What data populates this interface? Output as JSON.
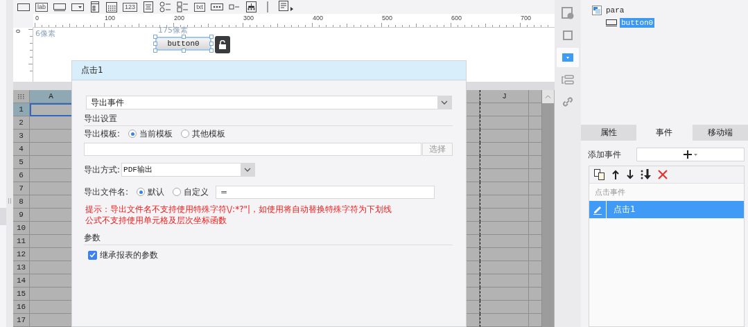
{
  "toolbar": [
    {
      "kind": "textbox"
    },
    {
      "kind": "label",
      "text": "lab"
    },
    {
      "kind": "button"
    },
    {
      "kind": "combo"
    },
    {
      "kind": "form"
    },
    {
      "kind": "calendar"
    },
    {
      "kind": "number",
      "text": "123"
    },
    {
      "kind": "textarea"
    },
    {
      "kind": "radio-group"
    },
    {
      "kind": "check-group"
    },
    {
      "kind": "text",
      "text": "txt"
    },
    {
      "kind": "password"
    },
    {
      "kind": "checkbox"
    },
    {
      "kind": "tree"
    },
    {
      "kind": "separator"
    },
    {
      "kind": "more"
    }
  ],
  "ruler": {
    "x_labels": [
      "0",
      "100",
      "200",
      "300",
      "400",
      "500",
      "600",
      "700"
    ],
    "y_label": "0"
  },
  "canvas": {
    "left_gap": "6像素",
    "top_gap": "175像素",
    "widget": {
      "text": "button0",
      "selected": true
    }
  },
  "dialog": {
    "title": "点击1",
    "event_type": "导出事件",
    "export_section": "导出设置",
    "template": {
      "label": "导出模板:",
      "options": [
        {
          "label": "当前模板",
          "selected": true
        },
        {
          "label": "其他模板",
          "selected": false
        }
      ],
      "browse_button": "选择"
    },
    "method": {
      "label": "导出方式:",
      "value": "PDF输出"
    },
    "filename": {
      "label": "导出文件名:",
      "options": [
        {
          "label": "默认",
          "selected": true
        },
        {
          "label": "自定义",
          "selected": false
        }
      ],
      "value": "="
    },
    "hint": [
      "提示：导出文件名不支持使用特殊字符\\/:*?\"|，如使用将自动替换特殊字符为下划线",
      "公式不支持使用单元格及层次坐标函数"
    ],
    "params_section": "参数",
    "inherit": {
      "label": "继承报表的参数",
      "checked": true
    }
  },
  "grid": {
    "columns": [
      {
        "label": "A",
        "selected": true
      },
      {
        "label": "J",
        "selected": false
      }
    ],
    "rows": [
      {
        "label": "1",
        "selected": true
      },
      {
        "label": "2",
        "selected": false
      },
      {
        "label": "3",
        "selected": false
      },
      {
        "label": "4",
        "selected": false
      },
      {
        "label": "5",
        "selected": false
      },
      {
        "label": "6",
        "selected": false
      },
      {
        "label": "7",
        "selected": false
      },
      {
        "label": "8",
        "selected": false
      },
      {
        "label": "9",
        "selected": false
      },
      {
        "label": "10",
        "selected": false
      },
      {
        "label": "11",
        "selected": false
      },
      {
        "label": "12",
        "selected": false
      },
      {
        "label": "13",
        "selected": false
      },
      {
        "label": "14",
        "selected": false
      },
      {
        "label": "15",
        "selected": false
      },
      {
        "label": "16",
        "selected": false
      },
      {
        "label": "17",
        "selected": false
      }
    ]
  },
  "side_icons": [
    {
      "kind": "cell-info",
      "selected": false
    },
    {
      "kind": "frame",
      "selected": false
    },
    {
      "kind": "widget",
      "selected": true
    },
    {
      "kind": "layout",
      "selected": false
    },
    {
      "kind": "link",
      "selected": false
    }
  ],
  "tree": {
    "label": "para",
    "children": [
      {
        "label": "button0",
        "selected": true
      }
    ]
  },
  "panel_tabs": [
    {
      "label": "属性",
      "selected": false
    },
    {
      "label": "事件",
      "selected": true
    },
    {
      "label": "移动端",
      "selected": false
    }
  ],
  "add_event": {
    "label": "添加事件"
  },
  "events": {
    "header": "点击事件",
    "items": [
      {
        "label": "点击1",
        "selected": true
      }
    ]
  }
}
